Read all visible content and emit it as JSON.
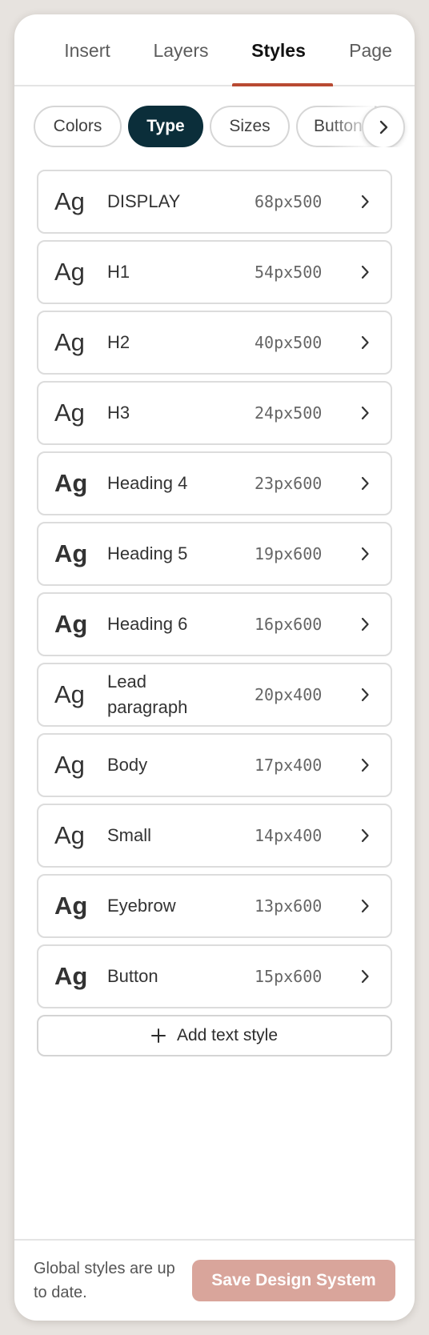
{
  "tabs": [
    {
      "label": "Insert"
    },
    {
      "label": "Layers"
    },
    {
      "label": "Styles"
    },
    {
      "label": "Page"
    }
  ],
  "active_tab": "Styles",
  "chips": [
    {
      "label": "Colors"
    },
    {
      "label": "Type"
    },
    {
      "label": "Sizes"
    },
    {
      "label": "Buttons"
    }
  ],
  "active_chip": "Type",
  "text_styles": [
    {
      "name": "DISPLAY",
      "size": "68px",
      "weight": "500",
      "sample": "Ag"
    },
    {
      "name": "H1",
      "size": "54px",
      "weight": "500",
      "sample": "Ag"
    },
    {
      "name": "H2",
      "size": "40px",
      "weight": "500",
      "sample": "Ag"
    },
    {
      "name": "H3",
      "size": "24px",
      "weight": "500",
      "sample": "Ag"
    },
    {
      "name": "Heading 4",
      "size": "23px",
      "weight": "600",
      "sample": "Ag"
    },
    {
      "name": "Heading 5",
      "size": "19px",
      "weight": "600",
      "sample": "Ag"
    },
    {
      "name": "Heading 6",
      "size": "16px",
      "weight": "600",
      "sample": "Ag"
    },
    {
      "name": "Lead paragraph",
      "size": "20px",
      "weight": "400",
      "sample": "Ag"
    },
    {
      "name": "Body",
      "size": "17px",
      "weight": "400",
      "sample": "Ag"
    },
    {
      "name": "Small",
      "size": "14px",
      "weight": "400",
      "sample": "Ag"
    },
    {
      "name": "Eyebrow",
      "size": "13px",
      "weight": "600",
      "sample": "Ag"
    },
    {
      "name": "Button",
      "size": "15px",
      "weight": "600",
      "sample": "Ag"
    }
  ],
  "add_style_label": "Add text style",
  "footer": {
    "status": "Global styles are up to date.",
    "save_label": "Save Design System"
  },
  "colors": {
    "accent_underline": "#b84a32",
    "active_chip_bg": "#0b2e3a",
    "save_button_bg": "#d9a59b",
    "page_bg": "#e7e3df"
  },
  "icons": {
    "chip_scroll": "chevron-right-icon",
    "row_open": "chevron-right-icon",
    "add": "plus-icon"
  }
}
